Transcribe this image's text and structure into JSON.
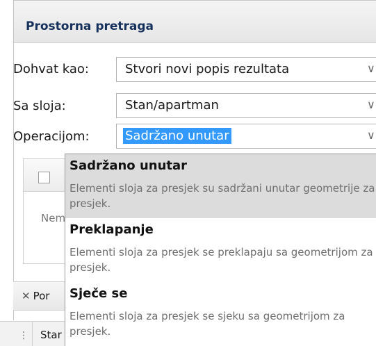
{
  "panel": {
    "title": "Prostorna pretraga"
  },
  "form": {
    "fetch_as": {
      "label": "Dohvat kao:",
      "value": "Stvori novi popis rezultata"
    },
    "layer": {
      "label": "Sa sloja:",
      "value": "Stan/apartman"
    },
    "operation": {
      "label": "Operacijom:",
      "value": "Sadržano unutar"
    }
  },
  "grid": {
    "empty_text_partial": "Nem"
  },
  "toolbar": {
    "clear_label_partial": "Por",
    "clear_icon": "close-icon"
  },
  "bottom": {
    "column_partial": "Star"
  },
  "dropdown": {
    "options": [
      {
        "title": "Sadržano unutar",
        "description": "Elementi sloja za presjek su sadržani unutar geometrije za presjek.",
        "selected": true
      },
      {
        "title": "Preklapanje",
        "description": "Elementi sloja za presjek se preklapaju sa geometrijom za presjek.",
        "selected": false
      },
      {
        "title": "Sječe se",
        "description": "Elementi sloja za presjek se sjeku sa geometrijom za presjek.",
        "selected": false
      }
    ]
  },
  "colors": {
    "title": "#15305a",
    "selection_highlight": "#3399ff",
    "selected_option_bg": "#dcdcdc",
    "description_text": "#6f6f6f"
  }
}
